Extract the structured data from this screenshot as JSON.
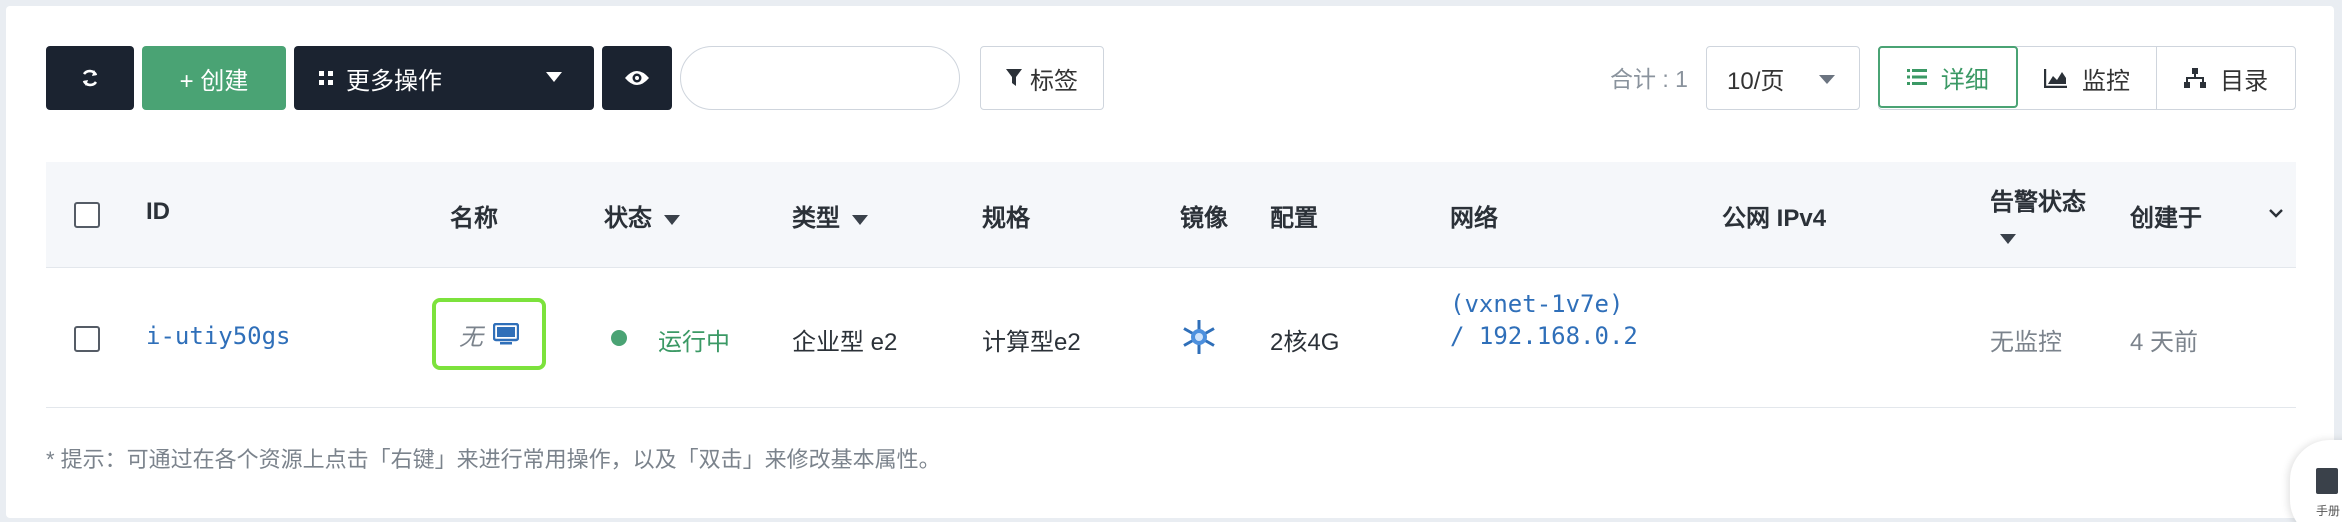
{
  "toolbar": {
    "create_label": "+ 创建",
    "more_label": "更多操作",
    "search_value": "",
    "search_placeholder": "",
    "tag_label": "标签",
    "total_label": "合计 : 1",
    "page_size": "10/页",
    "views": {
      "detail": "详细",
      "monitor": "监控",
      "catalog": "目录"
    },
    "active_view": "detail"
  },
  "table": {
    "headers": {
      "id": "ID",
      "name": "名称",
      "status": "状态",
      "type": "类型",
      "spec": "规格",
      "image": "镜像",
      "config": "配置",
      "network": "网络",
      "public_ip": "公网 IPv4",
      "alarm": "告警状态",
      "created": "创建于"
    },
    "rows": [
      {
        "id": "i-utiy50gs",
        "name": "无",
        "status": "运行中",
        "type": "企业型 e2",
        "spec": "计算型e2",
        "config": "2核4G",
        "network_line1": "(vxnet-1v7e)",
        "network_line2": "/ 192.168.0.2",
        "public_ip": "",
        "alarm": "无监控",
        "created": "4 天前"
      }
    ]
  },
  "tip": "* 提示：可通过在各个资源上点击「右键」来进行常用操作，以及「双击」来修改基本属性。",
  "side_widget_label": "手册",
  "colors": {
    "dark": "#1b2330",
    "green": "#4aa374",
    "link": "#2f6fb9",
    "highlight": "#7ce23c"
  },
  "icons": {
    "refresh": "refresh-icon",
    "grid": "grid-icon",
    "eye": "eye-icon",
    "filter": "filter-icon",
    "list": "list-icon",
    "chart": "chart-icon",
    "sitemap": "sitemap-icon",
    "monitor": "monitor-icon",
    "image": "snowflake-icon"
  }
}
